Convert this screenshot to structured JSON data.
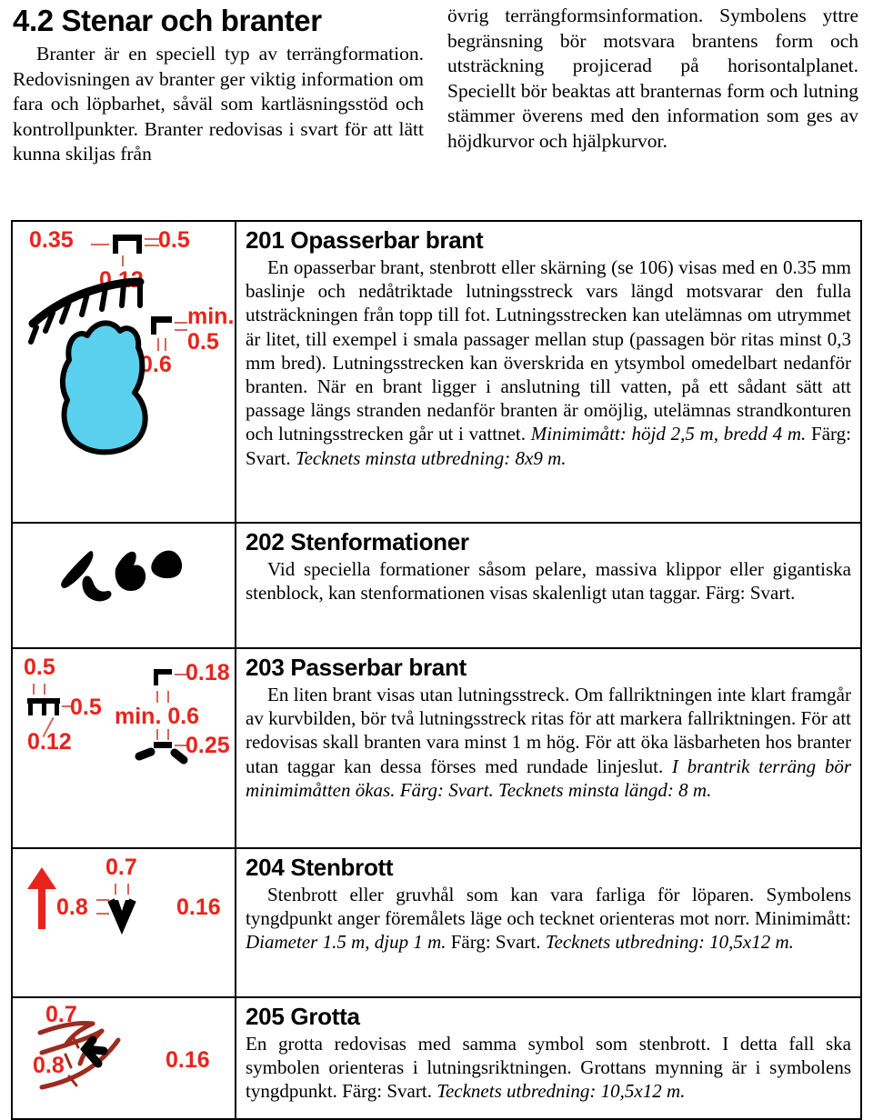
{
  "document": {
    "section_number": "4.2",
    "title": "4.2 Stenar och branter",
    "intro_left": "Branter är en speciell typ av terrängforma­tion. Redovisningen av branter ger viktig information om fara och löpbarhet, såväl som kartläsningsstöd och kontrollpunkter. Branter redovisas i svart för att lätt kunna skiljas från",
    "intro_right": "övrig terrängformsinformation. Symbolens yttre begränsning bör motsvara brantens form och utsträckning projicerad på horisontal­planet. Speciellt bör beaktas att branternas form och lutning stämmer överens med den information som ges av höjdkurvor och hjälpkurvor."
  },
  "colors": {
    "dimension_red": "#e8231b",
    "contour_brown": "#9b2b20",
    "water_blue": "#5ad0ef",
    "symbol_black": "#000000",
    "rule": "#000000"
  },
  "symbols": [
    {
      "id": "201",
      "title": "201 Opasserbar brant",
      "body": "En opasserbar brant, stenbrott eller skärning (se 106) visas med en 0.35 mm baslinje och nedåtriktade lutningsstreck vars längd motsvarar den fulla utsträckningen från topp till fot. Lutningsstrecken kan utelämnas om utrymmet är litet, till exempel i smala passager mellan stup (passagen bör ritas minst 0,3 mm bred). Lutningsstrecken kan överskrida en ytsymbol omedelbart nedanför branten. När en brant ligger i anslutning till vatten, på ett sådant sätt att passage längs stranden nedanför branten är omöjlig, utelämnas strandkonturen och lutningsstrecken går ut i vattnet. ",
      "body_italic_1": "Minimimått: höjd 2,5 m, bredd 4 m.",
      "body_tail": " Färg: Svart. ",
      "body_italic_2": "Tecknets minsta utbredning: 8x9 m.",
      "figure_labels": [
        "0.35",
        "0.5",
        "0.12",
        "min.",
        "0.5",
        "0.6"
      ]
    },
    {
      "id": "202",
      "title": "202 Stenformationer",
      "body": "Vid speciella formationer såsom pelare, massiva klippor eller gigantiska stenblock, kan stenformationen visas skalenligt utan taggar. Färg: Svart.",
      "figure_labels": []
    },
    {
      "id": "203",
      "title": "203 Passerbar brant",
      "body": "En liten brant visas utan lutningsstreck. Om fallriktningen inte klart framgår av kurvbilden, bör två lutningsstreck ritas för att markera fallriktningen. För att redovisas skall branten vara minst 1 m hög. För att öka läsbarheten hos branter utan taggar kan dessa förses med rundade linjeslut. ",
      "body_italic_1": "I brantrik terräng bör minimimåtten ökas. Färg: Svart. Tecknets minsta längd: 8 m.",
      "figure_labels": [
        "0.5",
        "0.12",
        "0.5",
        "0.18",
        "min. 0.6",
        "0.25"
      ]
    },
    {
      "id": "204",
      "title": "204 Stenbrott",
      "body": "Stenbrott eller gruvhål som kan vara farliga för löparen. Symbolens tyngdpunkt anger föremålets läge och tecknet orienteras mot norr. Minimimått: ",
      "body_italic_1": "Diameter 1.5 m, djup 1 m.",
      "body_tail": " Färg: Svart. ",
      "body_italic_2": "Tecknets utbredning: 10,5x12 m.",
      "figure_labels": [
        "0.7",
        "0.8",
        "0.16"
      ]
    },
    {
      "id": "205",
      "title": "205 Grotta",
      "body": "En grotta redovisas med samma symbol som stenbrott. I detta fall ska symbolen orienteras i lutningsriktningen. Grottans mynning är i symbolens tyngdpunkt. Färg: Svart. ",
      "body_italic_1": "Tecknets utbredning: 10,5x12 m.",
      "figure_labels": [
        "0.7",
        "0.8",
        "0.16"
      ]
    }
  ]
}
